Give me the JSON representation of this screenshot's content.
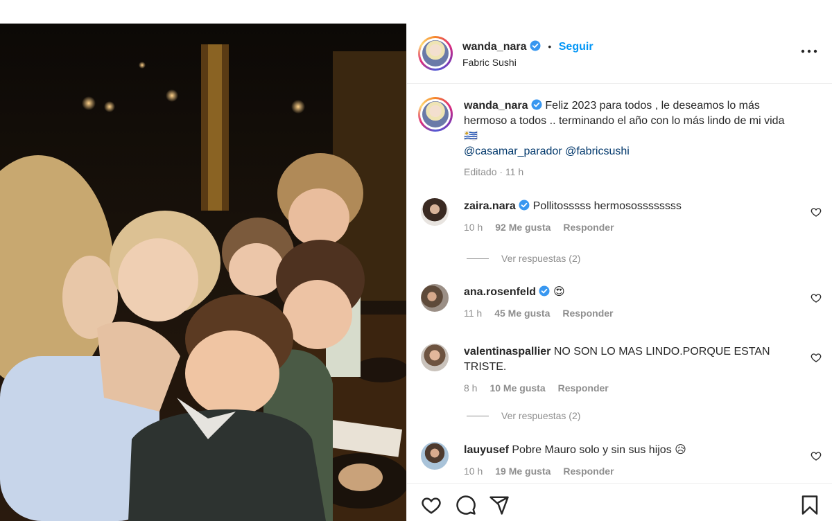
{
  "post": {
    "username": "wanda_nara",
    "follow_label": "Seguir",
    "separator": "•",
    "location": "Fabric Sushi",
    "more_label": "•••"
  },
  "caption": {
    "username": "wanda_nara",
    "text": "Feliz 2023 para todos , le deseamos lo más hermoso a todos .. terminando el año con lo más lindo de mi vida 🇺🇾",
    "mentions": [
      "@casamar_parador",
      "@fabricsushi"
    ],
    "edited": "Editado · 11 h"
  },
  "comments": [
    {
      "username": "zaira.nara",
      "verified": true,
      "text": "Pollitosssss hermosossssssss",
      "time": "10 h",
      "likes": "92 Me gusta",
      "reply": "Responder",
      "view_replies": "Ver respuestas (2)"
    },
    {
      "username": "ana.rosenfeld",
      "verified": true,
      "text": "😍",
      "time": "11 h",
      "likes": "45 Me gusta",
      "reply": "Responder"
    },
    {
      "username": "valentinaspallier",
      "verified": false,
      "text": "NO SON LO MAS LINDO.PORQUE ESTAN TRISTE.",
      "time": "8 h",
      "likes": "10 Me gusta",
      "reply": "Responder",
      "view_replies": "Ver respuestas (2)"
    },
    {
      "username": "lauyusef",
      "verified": false,
      "text": "Pobre Mauro solo y sin sus hijos 😥",
      "time": "10 h",
      "likes": "19 Me gusta",
      "reply": "Responder"
    }
  ],
  "icons": {
    "like": "heart-icon",
    "comment": "comment-icon",
    "share": "share-icon",
    "save": "bookmark-icon",
    "verified": "verified-badge-icon"
  },
  "colors": {
    "link_blue": "#0095f6",
    "mention": "#00376b",
    "secondary_text": "#8e8e8e",
    "verified": "#3897f0"
  }
}
